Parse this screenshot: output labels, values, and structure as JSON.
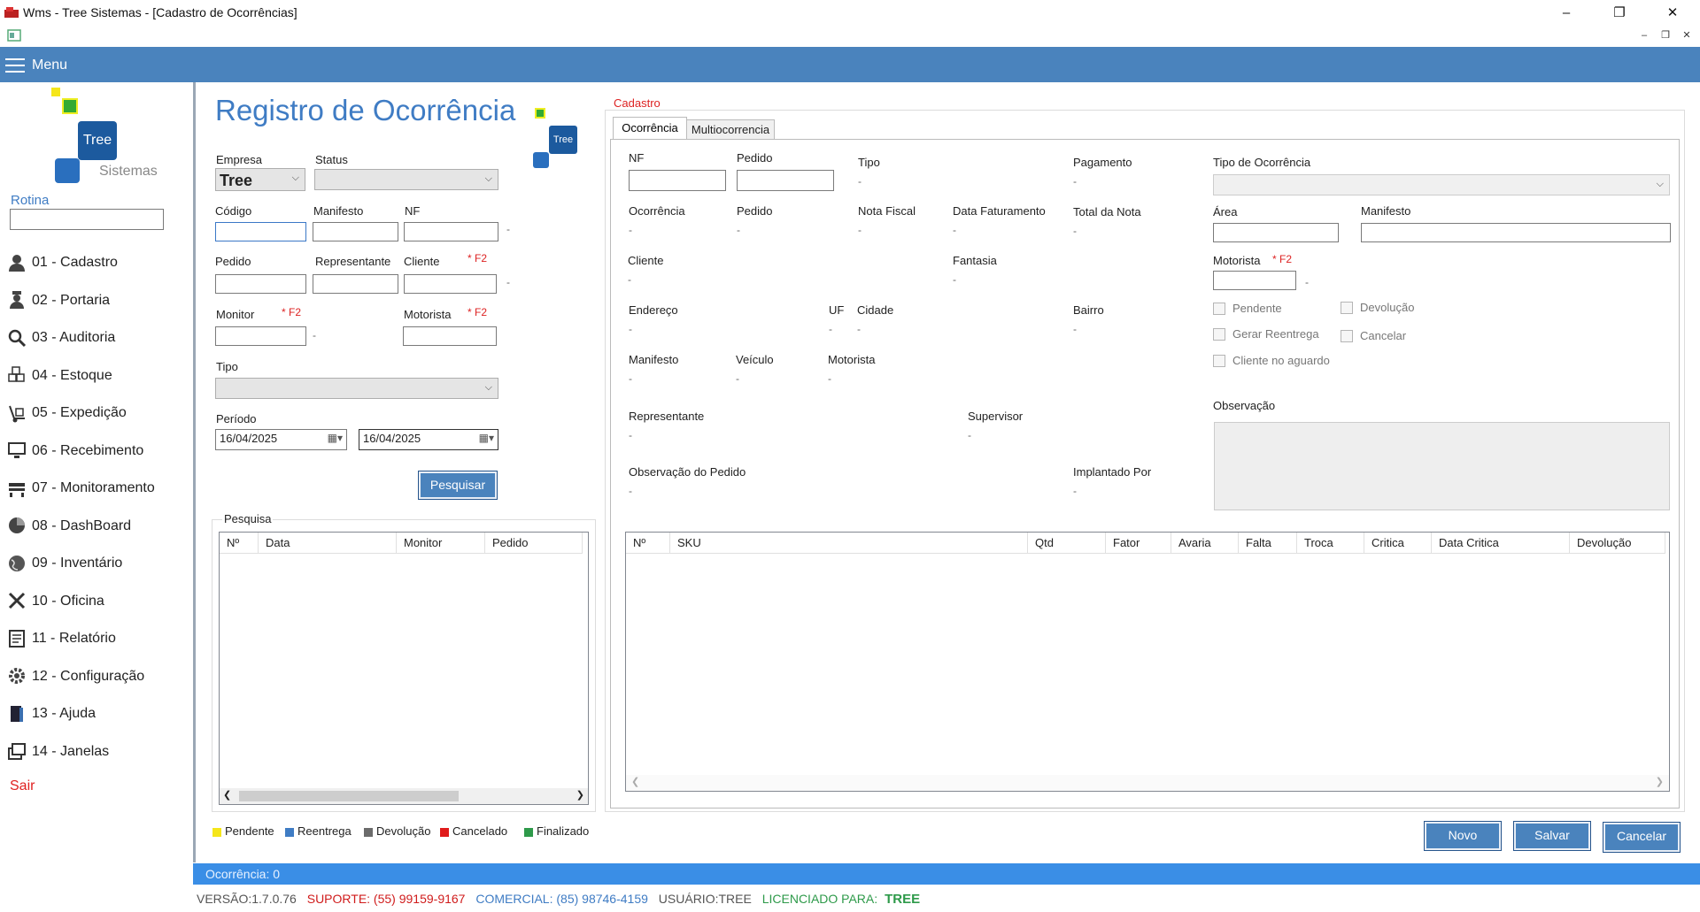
{
  "window": {
    "title": "Wms - Tree Sistemas - [Cadastro de Ocorrências]"
  },
  "menu": {
    "label": "Menu"
  },
  "logo": {
    "tree": "Tree",
    "sistemas": "Sistemas"
  },
  "sidebar": {
    "rotina_label": "Rotina",
    "items": [
      {
        "label": "01 - Cadastro",
        "icon": "user-icon"
      },
      {
        "label": "02 - Portaria",
        "icon": "guard-icon"
      },
      {
        "label": "03 - Auditoria",
        "icon": "magnifier-icon"
      },
      {
        "label": "04 - Estoque",
        "icon": "boxes-icon"
      },
      {
        "label": "05 - Expedição",
        "icon": "hand-truck-icon"
      },
      {
        "label": "06 - Recebimento",
        "icon": "monitor-icon"
      },
      {
        "label": "07 - Monitoramento",
        "icon": "truck-icon"
      },
      {
        "label": "08 - DashBoard",
        "icon": "pie-chart-icon"
      },
      {
        "label": "09 - Inventário",
        "icon": "globe-icon"
      },
      {
        "label": "10 - Oficina",
        "icon": "tools-icon"
      },
      {
        "label": "11 - Relatório",
        "icon": "report-icon"
      },
      {
        "label": "12 - Configuração",
        "icon": "gear-icon"
      },
      {
        "label": "13 - Ajuda",
        "icon": "door-icon"
      },
      {
        "label": "14 - Janelas",
        "icon": "windows-icon"
      }
    ],
    "exit": "Sair"
  },
  "search": {
    "title": "Registro de Ocorrência",
    "empresa_label": "Empresa",
    "empresa_value": "Tree",
    "status_label": "Status",
    "codigo_label": "Código",
    "manifesto_label": "Manifesto",
    "nf_label": "NF",
    "pedido_label": "Pedido",
    "representante_label": "Representante",
    "cliente_label": "Cliente",
    "monitor_label": "Monitor",
    "motorista_label": "Motorista",
    "f2": "* F2",
    "tipo_label": "Tipo",
    "periodo_label": "Período",
    "date_from": "16/04/2025",
    "date_to": "16/04/2025",
    "search_button": "Pesquisar",
    "group_label": "Pesquisa",
    "columns": [
      "Nº",
      "Data",
      "Monitor",
      "Pedido"
    ]
  },
  "legend": [
    {
      "label": "Pendente",
      "color": "#f5e61a"
    },
    {
      "label": "Reentrega",
      "color": "#3f7cc4"
    },
    {
      "label": "Devolução",
      "color": "#6b6b6b"
    },
    {
      "label": "Cancelado",
      "color": "#e01b1b"
    },
    {
      "label": "Finalizado",
      "color": "#2e9a4a"
    }
  ],
  "cadastro": {
    "group_label": "Cadastro",
    "tabs": [
      "Ocorrência",
      "Multiocorrencia"
    ],
    "nf": "NF",
    "pedido": "Pedido",
    "tipo": "Tipo",
    "pagamento": "Pagamento",
    "tipo_ocorrencia": "Tipo de Ocorrência",
    "ocorrencia": "Ocorrência",
    "pedido2": "Pedido",
    "nota_fiscal": "Nota Fiscal",
    "data_faturamento": "Data Faturamento",
    "total_nota": "Total da Nota",
    "area": "Área",
    "manifesto": "Manifesto",
    "cliente": "Cliente",
    "fantasia": "Fantasia",
    "motorista": "Motorista",
    "endereco": "Endereço",
    "uf": "UF",
    "cidade": "Cidade",
    "bairro": "Bairro",
    "manifesto2": "Manifesto",
    "veiculo": "Veículo",
    "motorista2": "Motorista",
    "representante": "Representante",
    "supervisor": "Supervisor",
    "observacao": "Observação",
    "observacao_pedido": "Observação do Pedido",
    "implantado_por": "Implantado Por",
    "empty_value": "-",
    "checkboxes": {
      "pendente": "Pendente",
      "devolucao": "Devolução",
      "gerar_reentrega": "Gerar Reentrega",
      "cancelar": "Cancelar",
      "cliente_aguardo": "Cliente no aguardo"
    },
    "columns": [
      "Nº",
      "SKU",
      "Qtd",
      "Fator",
      "Avaria",
      "Falta",
      "Troca",
      "Critica",
      "Data Critica",
      "Devolução"
    ]
  },
  "actions": {
    "novo": "Novo",
    "salvar": "Salvar",
    "cancelar": "Cancelar"
  },
  "status": {
    "text": "Ocorrência: 0"
  },
  "footer": {
    "versao": "VERSÃO:1.7.0.76",
    "suporte": "SUPORTE: (55) 99159-9167",
    "comercial": "COMERCIAL: (85) 98746-4159",
    "usuario": "USUÁRIO:TREE",
    "licenciado": "LICENCIADO PARA:",
    "licenciado_nome": "TREE",
    "colors": {
      "suporte": "#d01c1c",
      "comercial": "#3f7cc4",
      "licenciado": "#2e9a4a"
    }
  }
}
